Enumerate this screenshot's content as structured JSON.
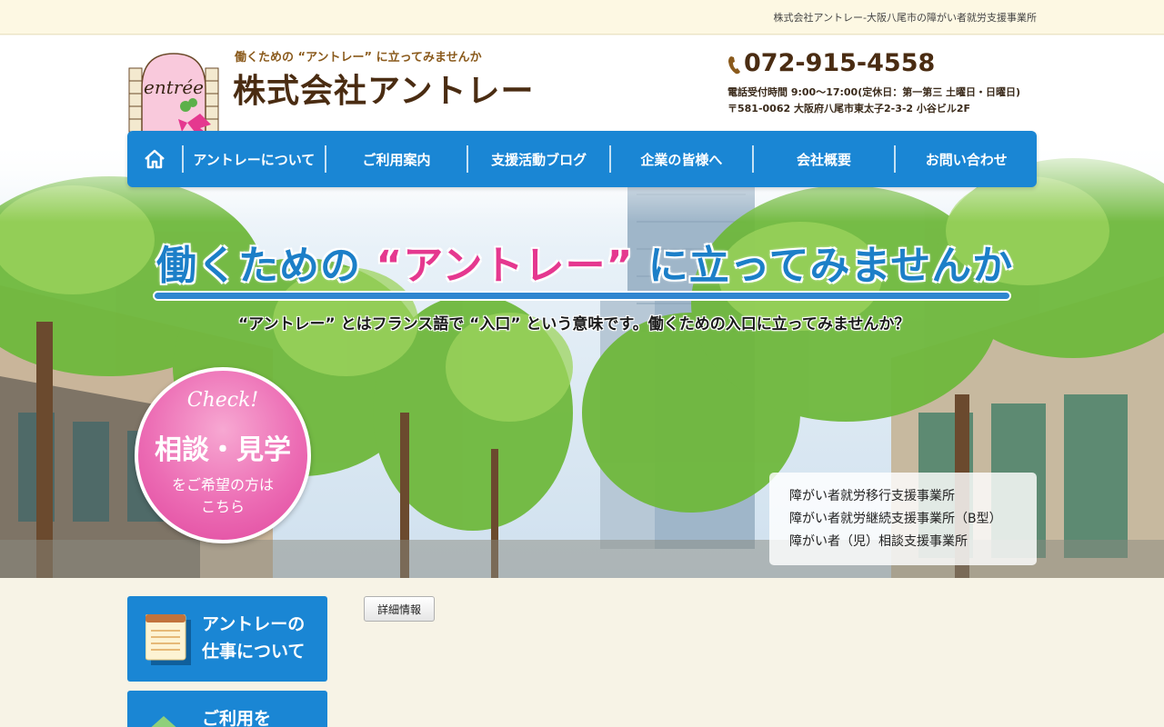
{
  "topbar": {
    "tagline": "株式会社アントレー-大阪八尾市の障がい者就労支援事業所"
  },
  "header": {
    "logo_text": "entrée",
    "catchphrase": "働くための “アントレー” に立ってみませんか",
    "company_name": "株式会社アントレー",
    "phone": "072-915-4558",
    "hours": "電話受付時間 9:00～17:00(定休日：第一第三 土曜日・日曜日)",
    "address": "〒581-0062 大阪府八尾市東太子2-3-2 小谷ビル2F"
  },
  "nav": {
    "items": [
      "アントレーについて",
      "ご利用案内",
      "支援活動ブログ",
      "企業の皆様へ",
      "会社概要",
      "お問い合わせ"
    ]
  },
  "hero": {
    "title_pre": "働くための",
    "title_highlight": "“アントレー”",
    "title_post": "に立ってみませんか",
    "subtitle": "“アントレー” とはフランス語で “入口” という意味です。働くための入口に立ってみませんか？"
  },
  "check": {
    "script": "Check!",
    "heading": "相談・見学",
    "line1": "をご希望の方は",
    "line2": "こちら"
  },
  "services": [
    "障がい者就労移行支援事業所",
    "障がい者就労継続支援事業所（B型）",
    "障がい者（児）相談支援事業所"
  ],
  "sidebar": {
    "work_line1": "アントレーの",
    "work_line2": "仕事について",
    "use_line1": "ご利用を"
  },
  "detail_button": "詳細情報",
  "colors": {
    "nav_blue": "#1a86d4",
    "accent_pink": "#e5388f",
    "brown": "#4a2c12"
  }
}
